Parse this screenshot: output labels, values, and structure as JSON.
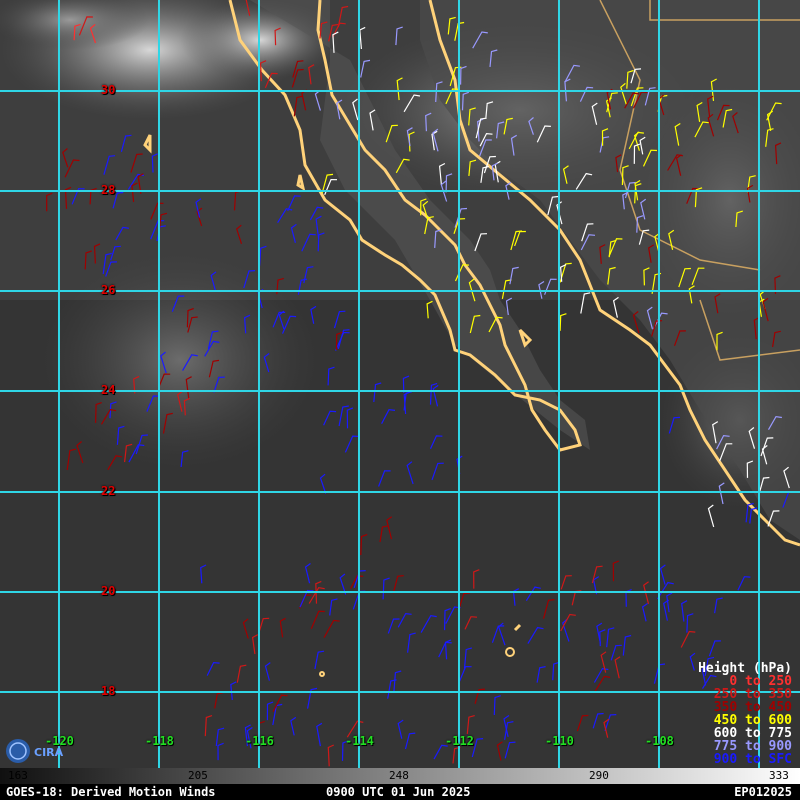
{
  "product": {
    "satellite_title": "GOES-18: Derived Motion Winds",
    "valid_time": "0900 UTC 01 Jun 2025",
    "storm_id": "EP012025"
  },
  "latitude_labels": [
    "30",
    "28",
    "26",
    "24",
    "22",
    "20",
    "18"
  ],
  "longitude_labels": [
    "-120",
    "-118",
    "-116",
    "-114",
    "-112",
    "-110",
    "-108"
  ],
  "legend": {
    "title": "Height (hPa)",
    "items": [
      {
        "label": "0 to 250",
        "color": "#ff3030"
      },
      {
        "label": "250 to 350",
        "color": "#d01818"
      },
      {
        "label": "350 to 450",
        "color": "#a00000"
      },
      {
        "label": "450 to 600",
        "color": "#ffff00"
      },
      {
        "label": "600 to 775",
        "color": "#ffffff"
      },
      {
        "label": "775 to 900",
        "color": "#9999ff"
      },
      {
        "label": "900 to SFC",
        "color": "#1a1aff"
      }
    ]
  },
  "colorbar": {
    "ticks": [
      "163",
      "205",
      "248",
      "290",
      "333"
    ]
  },
  "colors": {
    "grid": "#2fd6e6",
    "coastline": "#ffd27a",
    "border": "#c8a060"
  },
  "logo_text": "CIRA"
}
